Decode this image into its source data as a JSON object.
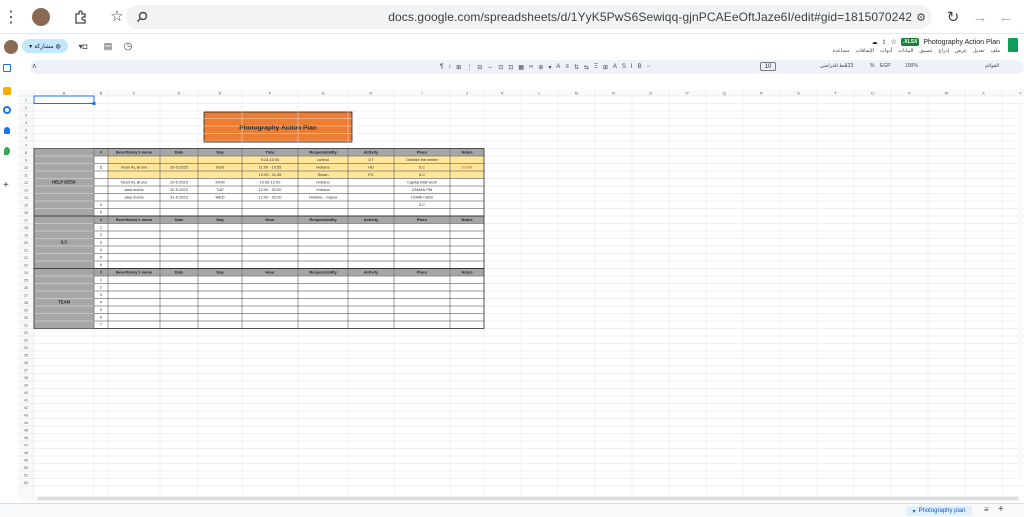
{
  "browser": {
    "url": "docs.google.com/spreadsheets/d/1YyK5PwS6Sewiqq-gjnPCAEeOftJaze6I/edit#gid=1815070242"
  },
  "doc": {
    "title": "Photography Action Plan",
    "badge": ".XLSX",
    "share": "مشاركة",
    "menus": [
      "ملف",
      "تعديل",
      "عرض",
      "إدراج",
      "تنسيق",
      "البيانات",
      "أدوات",
      "الإضافات",
      "مساعدة"
    ]
  },
  "toolbar": {
    "font_size": "10",
    "zoom": "100%",
    "currency": "EGP",
    "percent": "%",
    "format123": "123",
    "font": "خط افتراضي",
    "search": "القوائم"
  },
  "sheet": {
    "columns": [
      "A",
      "B",
      "C",
      "D",
      "E",
      "F",
      "G",
      "H",
      "I",
      "J",
      "K",
      "L",
      "M",
      "N",
      "O",
      "P",
      "Q",
      "R",
      "S",
      "T",
      "U",
      "V",
      "W",
      "X",
      "Y"
    ],
    "title_box": "Photography Action Plan",
    "sections": [
      {
        "label": "HELP DESK",
        "headers": [
          "#",
          "Beneficiary's name",
          "Date",
          "Day",
          "Time",
          "Responsibility",
          "Activity",
          "Place",
          "Notes"
        ],
        "rows": [
          [
            "",
            "",
            "",
            "",
            "9:15-10:00",
            "control",
            "OT",
            "Outside the center",
            ""
          ],
          [
            "1",
            "Noon AL Bruno",
            "26-5-2025",
            "SUN",
            "11:00 - 10:55",
            "Hollana",
            "HD",
            "ILC",
            "DONE"
          ],
          [
            "",
            "",
            "",
            "",
            "12:00 - 11:35",
            "Susan",
            "PC",
            "ILC",
            ""
          ],
          [
            "",
            "Noon AL Bruno",
            "29-5-2023",
            "MON",
            "10:30-12:00",
            "Hollana",
            "",
            "Capital Mall-work",
            ""
          ],
          [
            "",
            "alaa monia",
            "30-5-2023",
            "TUE",
            "12:00 - 02:00",
            "Hollana",
            "",
            "ZAMAN FM",
            ""
          ],
          [
            "",
            "alaa monia",
            "31-5-2023",
            "WED",
            "12:00 - 02:00",
            "Hollana , maysa",
            "",
            "HOME+Sissi",
            ""
          ],
          [
            "4",
            "",
            "",
            "",
            "",
            "",
            "",
            "ILC",
            ""
          ],
          [
            "5",
            "",
            "",
            "",
            "",
            "",
            "",
            "",
            ""
          ],
          [
            "6",
            "",
            "",
            "",
            "",
            "",
            "",
            "",
            ""
          ]
        ]
      },
      {
        "label": "ILC",
        "headers": [
          "#",
          "Beneficiary's name",
          "Date",
          "Day",
          "Hour",
          "Responsibility",
          "Activity",
          "Place",
          "Notes"
        ],
        "rows": [
          [
            "1"
          ],
          [
            "2"
          ],
          [
            "3"
          ],
          [
            "4"
          ],
          [
            "5"
          ],
          [
            "6"
          ]
        ]
      },
      {
        "label": "TEAM",
        "headers": [
          "#",
          "Beneficiary's name",
          "Date",
          "Day",
          "Hour",
          "Responsibility",
          "Activity",
          "Place",
          "Notes"
        ],
        "rows": [
          [
            "1"
          ],
          [
            "2"
          ],
          [
            "3"
          ],
          [
            "4"
          ],
          [
            "5"
          ],
          [
            "6"
          ],
          [
            "7"
          ]
        ]
      }
    ],
    "tab": "Photography plan"
  },
  "colors": {
    "header_gray": "#a6a6a6",
    "yellow": "#ffe699",
    "orange": "#ed7d31",
    "green_badge": "#188038",
    "blue_tab": "#c2e7ff"
  }
}
